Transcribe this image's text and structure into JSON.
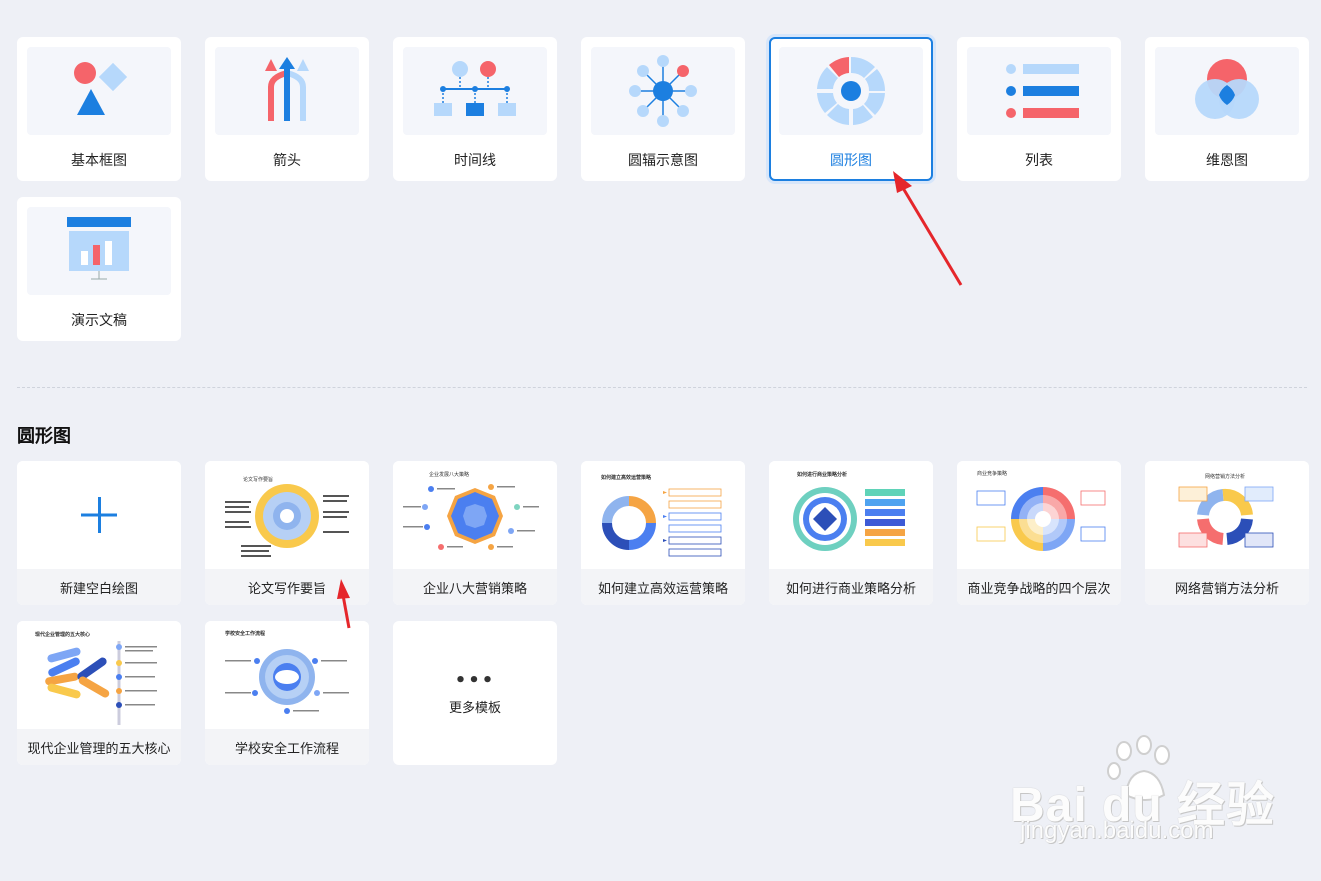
{
  "shape_categories": [
    {
      "label": "基本框图",
      "icon": "basic-shapes-icon",
      "selected": false
    },
    {
      "label": "箭头",
      "icon": "arrows-icon",
      "selected": false
    },
    {
      "label": "时间线",
      "icon": "timeline-icon",
      "selected": false
    },
    {
      "label": "圆辐示意图",
      "icon": "radial-icon",
      "selected": false
    },
    {
      "label": "圆形图",
      "icon": "circle-chart-icon",
      "selected": true
    },
    {
      "label": "列表",
      "icon": "list-icon",
      "selected": false
    },
    {
      "label": "维恩图",
      "icon": "venn-icon",
      "selected": false
    },
    {
      "label": "演示文稿",
      "icon": "presentation-icon",
      "selected": false
    }
  ],
  "section_title": "圆形图",
  "templates": [
    {
      "label": "新建空白绘图",
      "kind": "new"
    },
    {
      "label": "论文写作要旨",
      "thumb_title": "论文写作要旨"
    },
    {
      "label": "企业八大营销策略",
      "thumb_title": "企业发展八大策略"
    },
    {
      "label": "如何建立高效运营策略",
      "thumb_title": "如何建立高效运营策略"
    },
    {
      "label": "如何进行商业策略分析",
      "thumb_title": "如何进行商业策略分析"
    },
    {
      "label": "商业竞争战略的四个层次",
      "thumb_title": "商业竞争策略"
    },
    {
      "label": "网络营销方法分析",
      "thumb_title": "网络营销方法分析"
    },
    {
      "label": "现代企业管理的五大核心",
      "thumb_title": "现代企业管理的五大核心"
    },
    {
      "label": "学校安全工作流程",
      "thumb_title": "学校安全工作流程"
    }
  ],
  "more_templates": {
    "dots": "•••",
    "label": "更多模板"
  },
  "watermark": {
    "main": "Bai du 经验",
    "sub": "jingyan.baidu.com"
  },
  "colors": {
    "accent": "#1c7fe0",
    "arrow": "#e5262b",
    "blue": "#1c7fe0",
    "light_blue": "#b6d8fb",
    "red": "#f5646a"
  }
}
